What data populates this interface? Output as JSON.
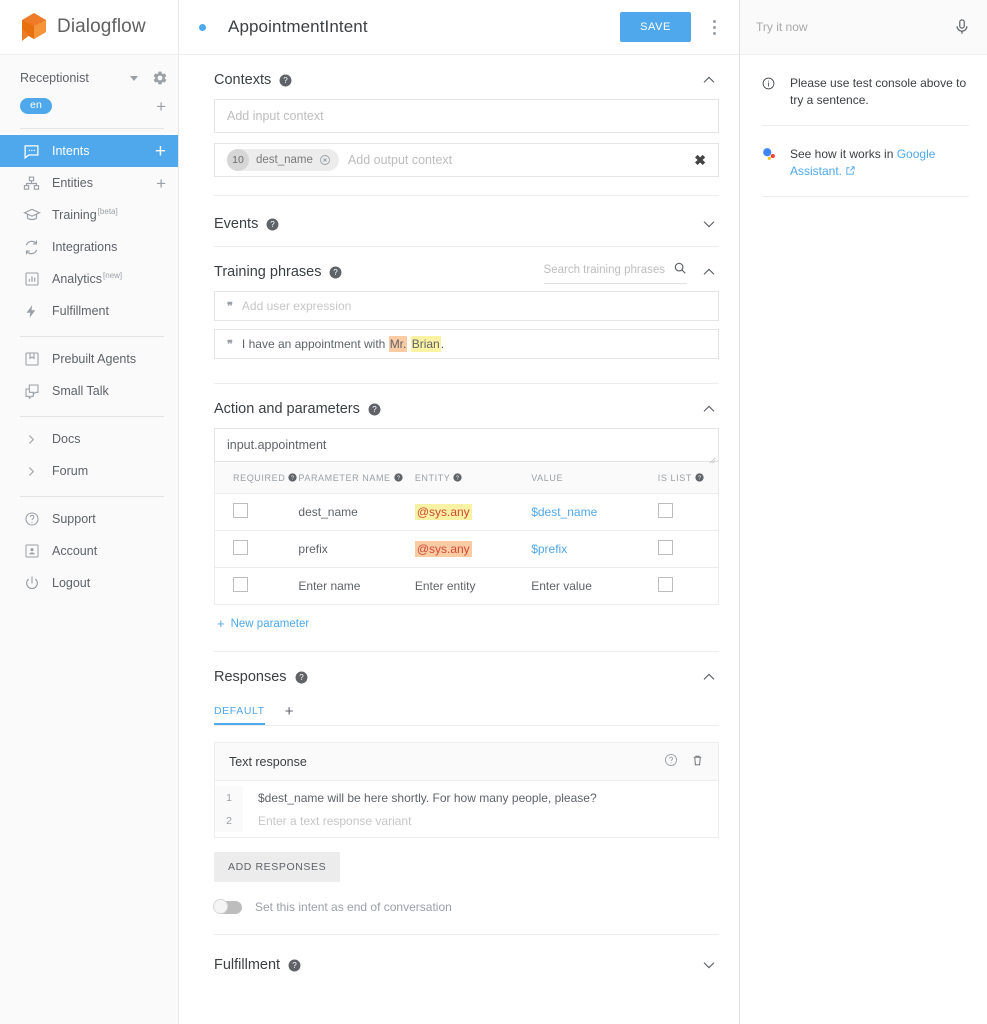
{
  "brand": {
    "name": "Dialogflow",
    "logo_color": "#EF7B28",
    "accent": "#4FA8EC"
  },
  "sidebar": {
    "agent": {
      "name": "Receptionist",
      "lang_badge": "en"
    },
    "items": [
      {
        "label": "Intents",
        "icon": "intents-icon",
        "active": true,
        "trailing": "+"
      },
      {
        "label": "Entities",
        "icon": "entities-icon",
        "active": false,
        "trailing": "+"
      },
      {
        "label": "Training",
        "icon": "training-icon",
        "active": false,
        "tag": "[beta]"
      },
      {
        "label": "Integrations",
        "icon": "integrations-icon",
        "active": false
      },
      {
        "label": "Analytics",
        "icon": "analytics-icon",
        "active": false,
        "tag": "[new]"
      },
      {
        "label": "Fulfillment",
        "icon": "fulfillment-icon",
        "active": false
      }
    ],
    "items2": [
      {
        "label": "Prebuilt Agents",
        "icon": "prebuilt-agents-icon"
      },
      {
        "label": "Small Talk",
        "icon": "small-talk-icon"
      }
    ],
    "items3": [
      {
        "label": "Docs",
        "icon": "chevron-right-icon"
      },
      {
        "label": "Forum",
        "icon": "chevron-right-icon"
      }
    ],
    "items4": [
      {
        "label": "Support",
        "icon": "support-icon"
      },
      {
        "label": "Account",
        "icon": "account-icon"
      },
      {
        "label": "Logout",
        "icon": "logout-icon"
      }
    ]
  },
  "header": {
    "intent_name": "AppointmentIntent",
    "save_label": "SAVE"
  },
  "contexts": {
    "title": "Contexts",
    "input_placeholder": "Add input context",
    "output_placeholder": "Add output context",
    "chip": {
      "count": "10",
      "label": "dest_name"
    }
  },
  "events": {
    "title": "Events"
  },
  "training_phrases": {
    "title": "Training phrases",
    "search_placeholder": "Search training phrases",
    "add_placeholder": "Add user expression",
    "phrases": [
      {
        "prefix_text": "I have an appointment with ",
        "hl_orange": "Mr.",
        "gap": " ",
        "hl_yellow": "Brian",
        "suffix_text": "."
      }
    ]
  },
  "action_parameters": {
    "title": "Action and parameters",
    "action_value": "input.appointment",
    "columns": [
      "REQUIRED",
      "PARAMETER NAME",
      "ENTITY",
      "VALUE",
      "IS LIST"
    ],
    "rows": [
      {
        "required": false,
        "name": "dest_name",
        "entity": "@sys.any",
        "entity_hl": "yellow",
        "value": "$dest_name",
        "is_list": false,
        "placeholder": false
      },
      {
        "required": false,
        "name": "prefix",
        "entity": "@sys.any",
        "entity_hl": "orange",
        "value": "$prefix",
        "is_list": false,
        "placeholder": false
      },
      {
        "required": false,
        "name": "Enter name",
        "entity": "Enter entity",
        "entity_hl": "none",
        "value": "Enter value",
        "is_list": false,
        "placeholder": true
      }
    ],
    "new_parameter_label": "New parameter"
  },
  "responses": {
    "title": "Responses",
    "tab_default": "DEFAULT",
    "tab_add": "+",
    "card_title": "Text response",
    "lines": [
      {
        "num": "1",
        "text": "$dest_name will be here shortly. For how many people, please?",
        "placeholder": false
      },
      {
        "num": "2",
        "text": "Enter a text response variant",
        "placeholder": true
      }
    ],
    "add_responses_label": "ADD RESPONSES",
    "end_of_conversation_label": "Set this intent as end of conversation",
    "end_of_conversation_on": false
  },
  "fulfillment": {
    "title": "Fulfillment"
  },
  "try_panel": {
    "placeholder": "Try it now",
    "info_text": "Please use test console above to try a sentence.",
    "assistant_prefix": "See how it works in ",
    "assistant_link": "Google Assistant."
  }
}
